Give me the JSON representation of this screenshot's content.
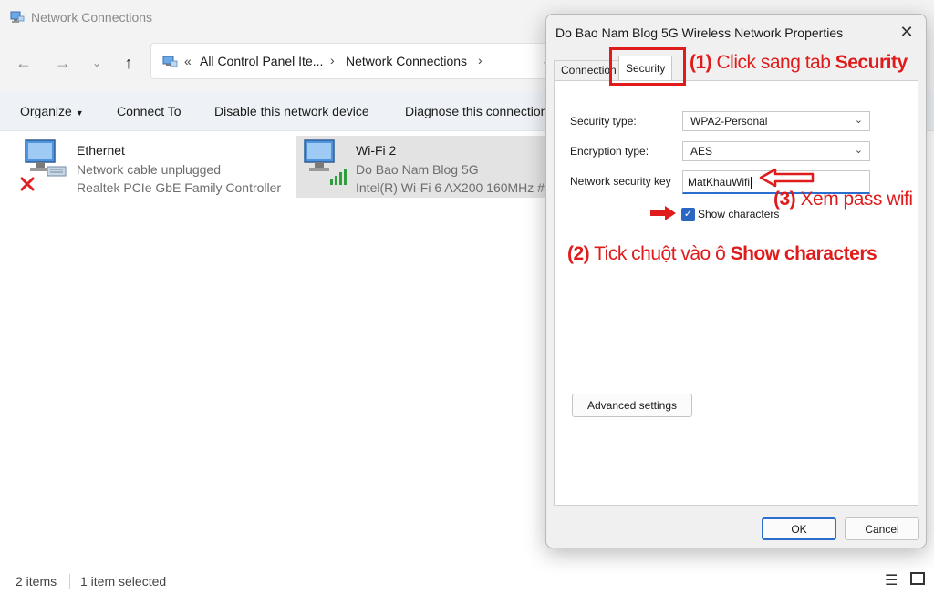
{
  "explorer": {
    "window_title": "Network Connections",
    "address": {
      "chevrons": "«",
      "crumb1": "All Control Panel Ite...",
      "crumb2": "Network Connections"
    },
    "commands": {
      "organize": "Organize",
      "connect_to": "Connect To",
      "disable": "Disable this network device",
      "diagnose": "Diagnose this connection"
    },
    "items": [
      {
        "name": "Ethernet",
        "status": "Network cable unplugged",
        "device": "Realtek PCIe GbE Family Controller"
      },
      {
        "name": "Wi-Fi 2",
        "status": "Do Bao Nam Blog 5G",
        "device": "Intel(R) Wi-Fi 6 AX200 160MHz #"
      }
    ],
    "status_bar": {
      "count": "2 items",
      "selected": "1 item selected"
    }
  },
  "dialog": {
    "title": "Do Bao Nam Blog 5G Wireless Network Properties",
    "tabs": [
      "Connection",
      "Security"
    ],
    "security_type_label": "Security type:",
    "security_type_value": "WPA2-Personal",
    "encryption_type_label": "Encryption type:",
    "encryption_type_value": "AES",
    "key_label": "Network security key",
    "key_value": "MatKhauWifi",
    "show_characters": "Show characters",
    "show_characters_checked": true,
    "advanced_button": "Advanced settings",
    "ok_button": "OK",
    "cancel_button": "Cancel"
  },
  "annotations": {
    "step1_prefix": "(1)",
    "step1_text": " Click sang tab ",
    "step1_bold": "Security",
    "step2_prefix": "(2)",
    "step2_text": " Tick chuột vào ô ",
    "step2_bold": "Show characters",
    "step3_prefix": "(3)",
    "step3_text": " Xem pass wifi"
  },
  "colors": {
    "annotation": "#e01b1b",
    "accent": "#2a6fcf",
    "selection": "#e3e3e3",
    "command_bar": "#eef2f6"
  }
}
